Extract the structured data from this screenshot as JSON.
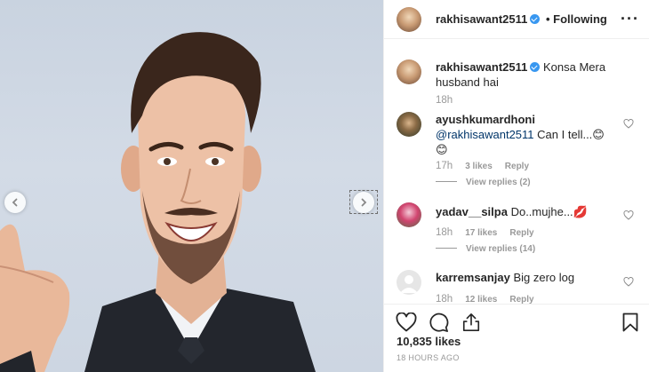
{
  "post": {
    "author": "rakhisawant2511",
    "follow_separator": "•",
    "follow_status": "Following",
    "more_glyph": "···",
    "caption": {
      "username": "rakhisawant2511",
      "text": "Konsa Mera husband hai",
      "time": "18h"
    },
    "likes_count": "10,835 likes",
    "timestamp": "18 HOURS AGO"
  },
  "comments": [
    {
      "username": "ayushkumardhoni",
      "mention": "@rakhisawant2511",
      "text": "Can I tell...😊😊",
      "time": "17h",
      "likes": "3 likes",
      "reply": "Reply",
      "view_replies": "View replies (2)"
    },
    {
      "username": "yadav__silpa",
      "text": "Do..mujhe...💋",
      "time": "18h",
      "likes": "17 likes",
      "reply": "Reply",
      "view_replies": "View replies (14)"
    },
    {
      "username": "karremsanjay",
      "text": "Big zero log",
      "time": "18h",
      "likes": "12 likes",
      "reply": "Reply"
    }
  ],
  "icons": {
    "verified": "verified-badge-icon",
    "like": "heart-icon",
    "comment": "comment-bubble-icon",
    "share": "share-icon",
    "save": "bookmark-icon",
    "prev": "chevron-left-icon",
    "next": "chevron-right-icon"
  },
  "colors": {
    "verified_blue": "#3897f0",
    "meta_gray": "#999999",
    "text": "#262626",
    "mention": "#003569"
  }
}
